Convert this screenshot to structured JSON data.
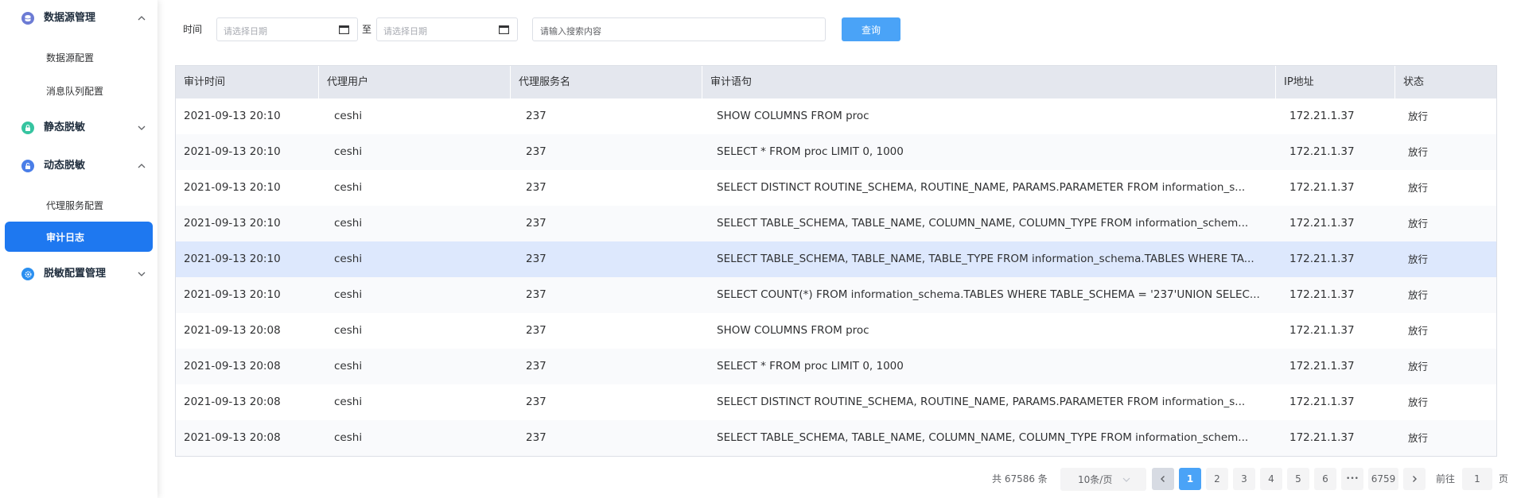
{
  "sidebar": {
    "groups": [
      {
        "label": "数据源管理",
        "items": [
          "数据源配置",
          "消息队列配置"
        ],
        "icon": "database-icon",
        "expanded": true
      },
      {
        "label": "静态脱敏",
        "items": [],
        "icon": "lock-icon",
        "expanded": false
      },
      {
        "label": "动态脱敏",
        "items": [
          "代理服务配置",
          "审计日志"
        ],
        "icon": "unlock-icon",
        "expanded": true
      },
      {
        "label": "脱敏配置管理",
        "items": [],
        "icon": "gear-icon",
        "expanded": false
      }
    ],
    "active_item": "审计日志"
  },
  "filters": {
    "time_label": "时间",
    "start_placeholder": "请选择日期",
    "range_sep": "至",
    "end_placeholder": "请选择日期",
    "search_placeholder": "请输入搜索内容",
    "query_label": "查询"
  },
  "table": {
    "columns": [
      "审计时间",
      "代理用户",
      "代理服务名",
      "审计语句",
      "IP地址",
      "状态"
    ],
    "rows": [
      [
        "2021-09-13 20:10",
        "ceshi",
        "237",
        "SHOW COLUMNS FROM proc",
        "172.21.1.37",
        "放行"
      ],
      [
        "2021-09-13 20:10",
        "ceshi",
        "237",
        "SELECT * FROM proc LIMIT 0, 1000",
        "172.21.1.37",
        "放行"
      ],
      [
        "2021-09-13 20:10",
        "ceshi",
        "237",
        "SELECT DISTINCT ROUTINE_SCHEMA, ROUTINE_NAME, PARAMS.PARAMETER FROM information_s...",
        "172.21.1.37",
        "放行"
      ],
      [
        "2021-09-13 20:10",
        "ceshi",
        "237",
        "SELECT TABLE_SCHEMA, TABLE_NAME, COLUMN_NAME, COLUMN_TYPE FROM information_schem...",
        "172.21.1.37",
        "放行"
      ],
      [
        "2021-09-13 20:10",
        "ceshi",
        "237",
        "SELECT TABLE_SCHEMA, TABLE_NAME, TABLE_TYPE FROM information_schema.TABLES WHERE TA...",
        "172.21.1.37",
        "放行"
      ],
      [
        "2021-09-13 20:10",
        "ceshi",
        "237",
        "SELECT COUNT(*) FROM information_schema.TABLES WHERE TABLE_SCHEMA = '237'UNION SELEC...",
        "172.21.1.37",
        "放行"
      ],
      [
        "2021-09-13 20:08",
        "ceshi",
        "237",
        "SHOW COLUMNS FROM proc",
        "172.21.1.37",
        "放行"
      ],
      [
        "2021-09-13 20:08",
        "ceshi",
        "237",
        "SELECT * FROM proc LIMIT 0, 1000",
        "172.21.1.37",
        "放行"
      ],
      [
        "2021-09-13 20:08",
        "ceshi",
        "237",
        "SELECT DISTINCT ROUTINE_SCHEMA, ROUTINE_NAME, PARAMS.PARAMETER FROM information_s...",
        "172.21.1.37",
        "放行"
      ],
      [
        "2021-09-13 20:08",
        "ceshi",
        "237",
        "SELECT TABLE_SCHEMA, TABLE_NAME, COLUMN_NAME, COLUMN_TYPE FROM information_schem...",
        "172.21.1.37",
        "放行"
      ]
    ],
    "highlighted_row": 5
  },
  "pagination": {
    "total": "共 67586 条",
    "page_size": "10条/页",
    "pages": [
      "1",
      "2",
      "3",
      "4",
      "5",
      "6"
    ],
    "ellipsis": "•••",
    "last_page": "6759",
    "current_page": "1",
    "goto_prefix": "前往",
    "goto_value": "1",
    "goto_suffix": "页"
  },
  "colors": {
    "accent": "#1e78f0",
    "button": "#4aa3f7",
    "row_highlight": "#dde8fd",
    "header_bg": "#e4e7ee"
  }
}
